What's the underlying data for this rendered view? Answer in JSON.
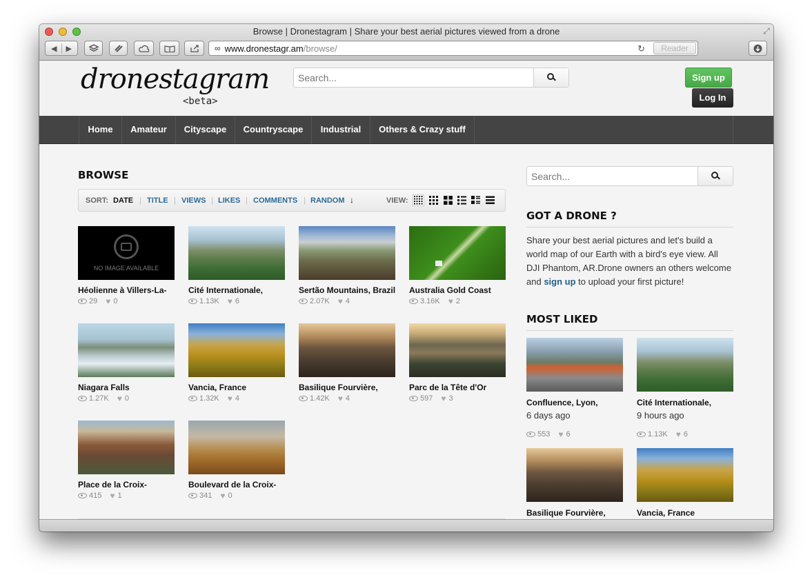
{
  "browser": {
    "window_title": "Browse | Dronestagram | Share your best aerial pictures viewed from a drone",
    "url_domain": "www.dronestagr.am",
    "url_path": "/browse/",
    "reader_label": "Reader",
    "traffic_lights": [
      "#ec5b52",
      "#f1bb3a",
      "#5fc342"
    ]
  },
  "header": {
    "logo": "dronestagram",
    "logo_sub": "<beta>",
    "search_placeholder": "Search...",
    "signup_label": "Sign up",
    "login_label": "Log In"
  },
  "nav": [
    "Home",
    "Amateur",
    "Cityscape",
    "Countryscape",
    "Industrial",
    "Others & Crazy stuff"
  ],
  "browse": {
    "title": "BROWSE",
    "sort_label": "SORT:",
    "sort_options": [
      "DATE",
      "TITLE",
      "VIEWS",
      "LIKES",
      "COMMENTS",
      "RANDOM"
    ],
    "active_sort": "DATE",
    "view_label": "VIEW:",
    "items": [
      {
        "title": "Héolienne à Villers-La-",
        "views": "29",
        "likes": "0",
        "no_image_text": "NO IMAGE AVAILABLE"
      },
      {
        "title": "Cité Internationale,",
        "views": "1.13K",
        "likes": "6"
      },
      {
        "title": "Sertão Mountains, Brazil",
        "views": "2.07K",
        "likes": "4"
      },
      {
        "title": "Australia Gold Coast",
        "views": "3.16K",
        "likes": "2"
      },
      {
        "title": "Niagara Falls",
        "views": "1.27K",
        "likes": "0"
      },
      {
        "title": "Vancia, France",
        "views": "1.32K",
        "likes": "4"
      },
      {
        "title": "Basilique Fourvière,",
        "views": "1.42K",
        "likes": "4"
      },
      {
        "title": "Parc de la Tête d'Or",
        "views": "597",
        "likes": "3"
      },
      {
        "title": "Place de la Croix-",
        "views": "415",
        "likes": "1"
      },
      {
        "title": "Boulevard de la Croix-",
        "views": "341",
        "likes": "0"
      }
    ]
  },
  "sidebar": {
    "search_placeholder": "Search...",
    "drone_title": "GOT A DRONE ?",
    "drone_text_before": "Share your best aerial pictures and let's build a world map of our Earth with a bird's eye view. All DJI Phantom, AR.Drone owners an others welcome and ",
    "drone_link": "sign up",
    "drone_text_after": " to upload your first picture!",
    "most_liked_title": "MOST LIKED",
    "most_liked": [
      {
        "title": "Confluence, Lyon,",
        "time": "6 days ago",
        "views": "553",
        "likes": "6"
      },
      {
        "title": "Cité Internationale,",
        "time": "9 hours ago",
        "views": "1.13K",
        "likes": "6"
      },
      {
        "title": "Basilique Fourvière,"
      },
      {
        "title": "Vancia, France"
      }
    ]
  },
  "colors": {
    "nav_bg": "#444444",
    "link": "#2a6a96",
    "signup": "#52b652"
  }
}
